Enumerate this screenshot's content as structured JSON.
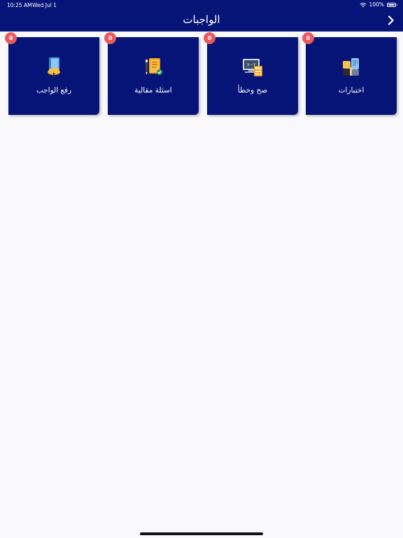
{
  "status": {
    "time": "10:25 AM",
    "date": "Wed Jul 1",
    "battery": "100%"
  },
  "header": {
    "title": "الواجبات",
    "back_icon": "chevron-right-icon"
  },
  "cards": [
    {
      "label": "اختبارات",
      "badge": "0",
      "icon": "quiz-icon"
    },
    {
      "label": "صح وخطأ",
      "badge": "0",
      "icon": "true-false-icon"
    },
    {
      "label": "اسئلة مقالية",
      "badge": "0",
      "icon": "essay-icon"
    },
    {
      "label": "رفع الواجب",
      "badge": "0",
      "icon": "upload-homework-icon"
    }
  ],
  "colors": {
    "primary": "#061478",
    "badge": "#e85a5f",
    "background": "#f9f9fb"
  }
}
